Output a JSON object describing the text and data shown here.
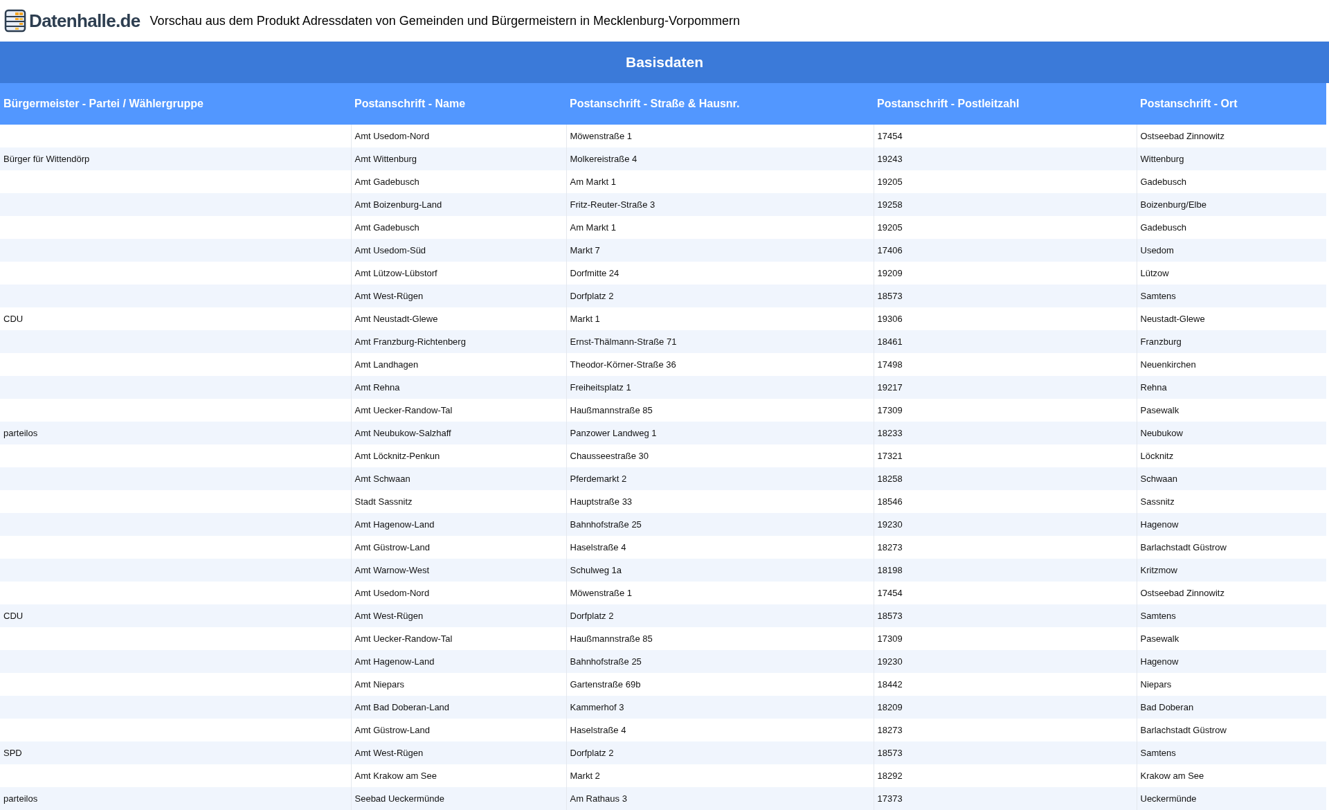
{
  "header": {
    "logo_text": "Datenhalle.de",
    "title": "Vorschau aus dem Produkt Adressdaten von Gemeinden und Bürgermeistern in Mecklenburg-Vorpommern"
  },
  "section_title": "Basisdaten",
  "table": {
    "columns": [
      "Bürgermeister - Partei / Wählergruppe",
      "Postanschrift - Name",
      "Postanschrift - Straße & Hausnr.",
      "Postanschrift - Postleitzahl",
      "Postanschrift - Ort"
    ],
    "rows": [
      [
        "",
        "Amt Usedom-Nord",
        "Möwenstraße 1",
        "17454",
        "Ostseebad Zinnowitz"
      ],
      [
        "Bürger für Wittendörp",
        "Amt Wittenburg",
        "Molkereistraße 4",
        "19243",
        "Wittenburg"
      ],
      [
        "",
        "Amt Gadebusch",
        "Am Markt 1",
        "19205",
        "Gadebusch"
      ],
      [
        "",
        "Amt Boizenburg-Land",
        "Fritz-Reuter-Straße 3",
        "19258",
        "Boizenburg/Elbe"
      ],
      [
        "",
        "Amt Gadebusch",
        "Am Markt 1",
        "19205",
        "Gadebusch"
      ],
      [
        "",
        "Amt Usedom-Süd",
        "Markt 7",
        "17406",
        "Usedom"
      ],
      [
        "",
        "Amt Lützow-Lübstorf",
        "Dorfmitte 24",
        "19209",
        "Lützow"
      ],
      [
        "",
        "Amt West-Rügen",
        "Dorfplatz 2",
        "18573",
        "Samtens"
      ],
      [
        "CDU",
        "Amt Neustadt-Glewe",
        "Markt 1",
        "19306",
        "Neustadt-Glewe"
      ],
      [
        "",
        "Amt Franzburg-Richtenberg",
        "Ernst-Thälmann-Straße 71",
        "18461",
        "Franzburg"
      ],
      [
        "",
        "Amt Landhagen",
        "Theodor-Körner-Straße 36",
        "17498",
        "Neuenkirchen"
      ],
      [
        "",
        "Amt Rehna",
        "Freiheitsplatz 1",
        "19217",
        "Rehna"
      ],
      [
        "",
        "Amt Uecker-Randow-Tal",
        "Haußmannstraße 85",
        "17309",
        "Pasewalk"
      ],
      [
        "parteilos",
        "Amt Neubukow-Salzhaff",
        "Panzower Landweg 1",
        "18233",
        "Neubukow"
      ],
      [
        "",
        "Amt Löcknitz-Penkun",
        "Chausseestraße 30",
        "17321",
        "Löcknitz"
      ],
      [
        "",
        "Amt Schwaan",
        "Pferdemarkt 2",
        "18258",
        "Schwaan"
      ],
      [
        "",
        "Stadt Sassnitz",
        "Hauptstraße 33",
        "18546",
        "Sassnitz"
      ],
      [
        "",
        "Amt Hagenow-Land",
        "Bahnhofstraße 25",
        "19230",
        "Hagenow"
      ],
      [
        "",
        "Amt Güstrow-Land",
        "Haselstraße 4",
        "18273",
        "Barlachstadt Güstrow"
      ],
      [
        "",
        "Amt Warnow-West",
        "Schulweg 1a",
        "18198",
        "Kritzmow"
      ],
      [
        "",
        "Amt Usedom-Nord",
        "Möwenstraße 1",
        "17454",
        "Ostseebad Zinnowitz"
      ],
      [
        "CDU",
        "Amt West-Rügen",
        "Dorfplatz 2",
        "18573",
        "Samtens"
      ],
      [
        "",
        "Amt Uecker-Randow-Tal",
        "Haußmannstraße 85",
        "17309",
        "Pasewalk"
      ],
      [
        "",
        "Amt Hagenow-Land",
        "Bahnhofstraße 25",
        "19230",
        "Hagenow"
      ],
      [
        "",
        "Amt Niepars",
        "Gartenstraße 69b",
        "18442",
        "Niepars"
      ],
      [
        "",
        "Amt Bad Doberan-Land",
        "Kammerhof 3",
        "18209",
        "Bad Doberan"
      ],
      [
        "",
        "Amt Güstrow-Land",
        "Haselstraße 4",
        "18273",
        "Barlachstadt Güstrow"
      ],
      [
        "SPD",
        "Amt West-Rügen",
        "Dorfplatz 2",
        "18573",
        "Samtens"
      ],
      [
        "",
        "Amt Krakow am See",
        "Markt 2",
        "18292",
        "Krakow am See"
      ],
      [
        "parteilos",
        "Seebad Ueckermünde",
        "Am Rathaus 3",
        "17373",
        "Ueckermünde"
      ]
    ]
  }
}
